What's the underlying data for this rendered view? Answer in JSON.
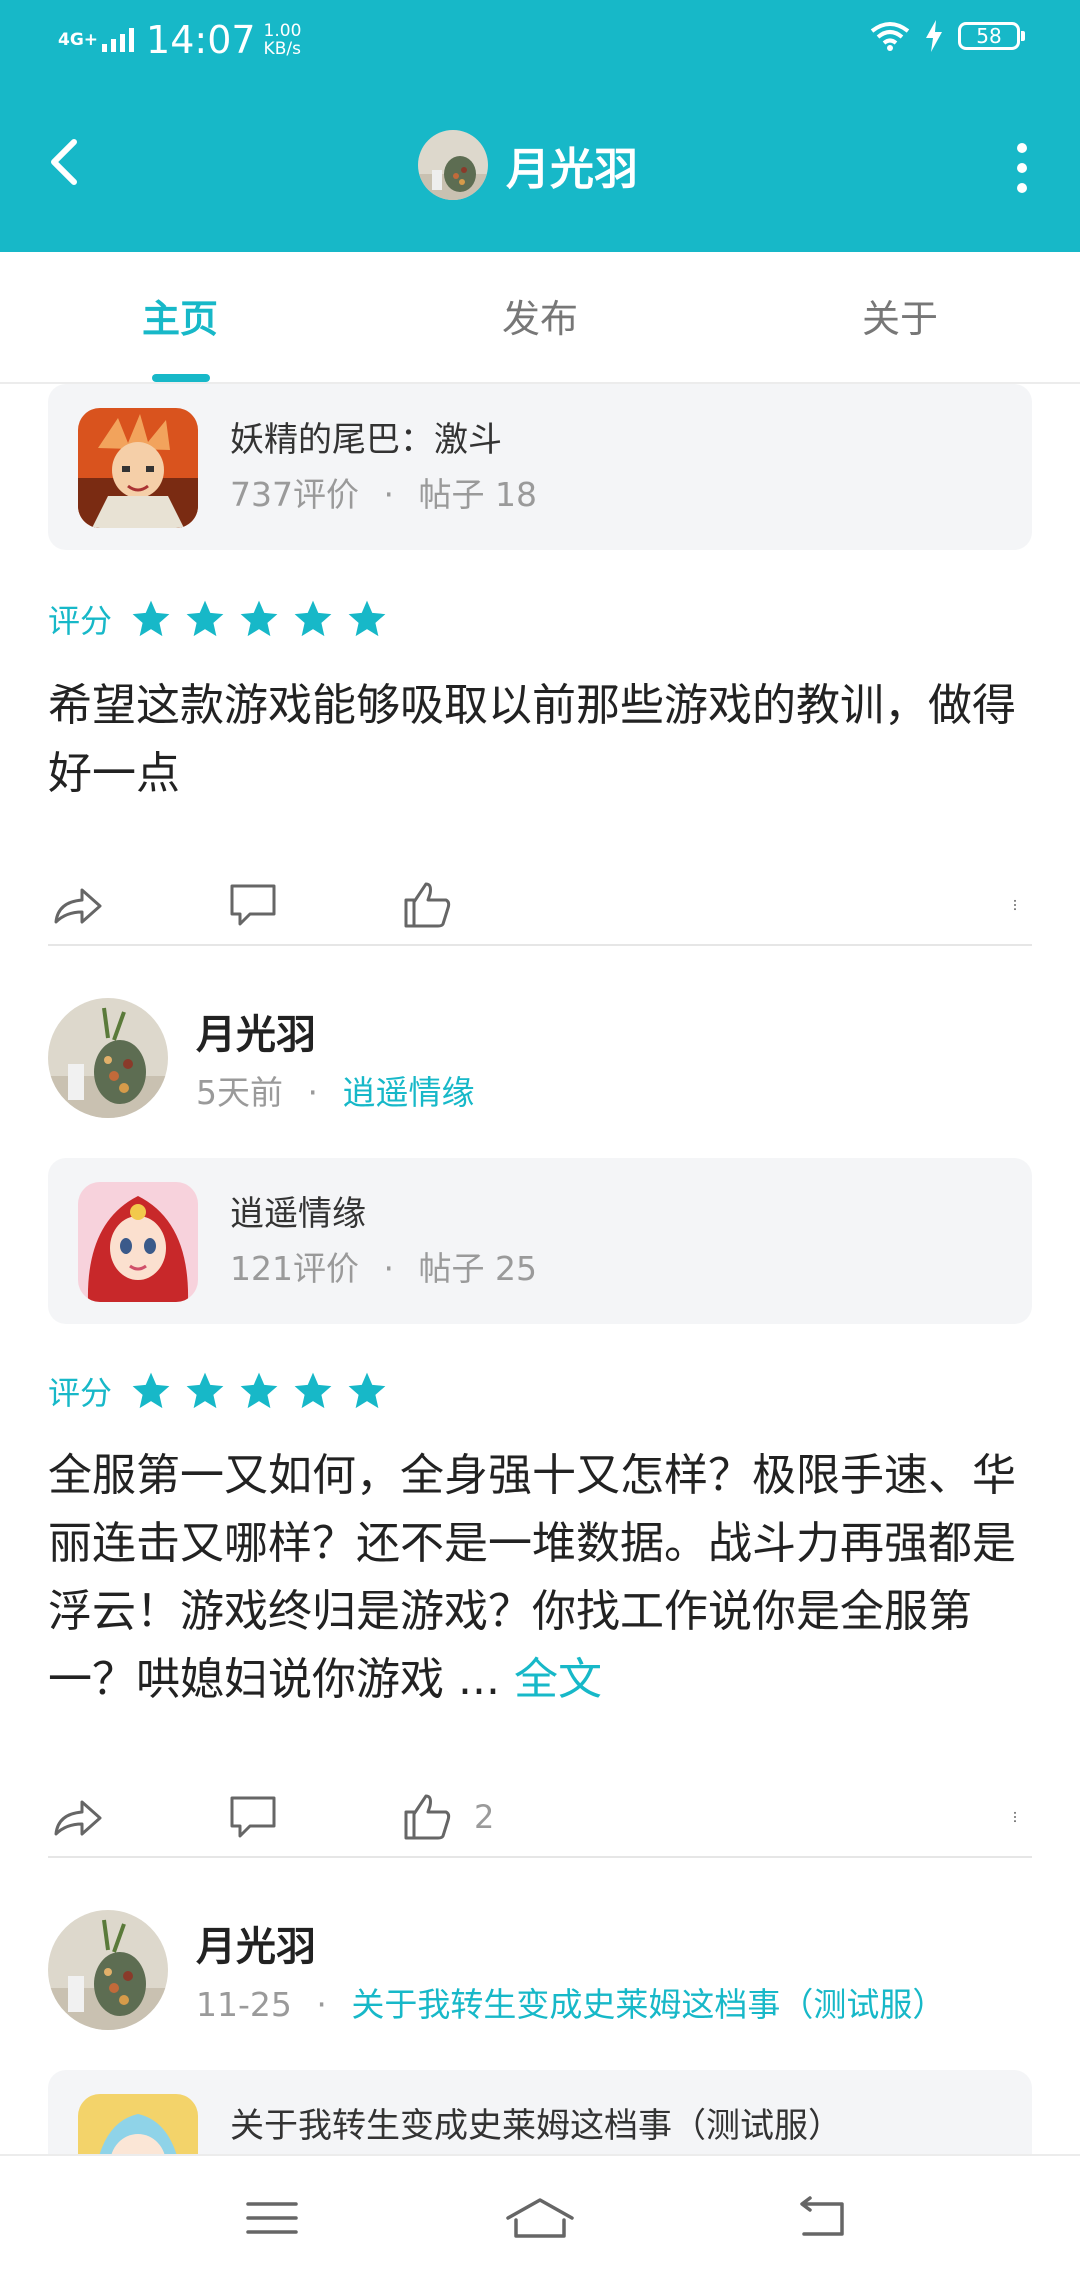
{
  "status_bar": {
    "network": "4G+",
    "time": "14:07",
    "speed_value": "1.00",
    "speed_unit": "KB/s",
    "battery": "58"
  },
  "header": {
    "title": "月光羽"
  },
  "tabs": [
    {
      "label": "主页",
      "active": true
    },
    {
      "label": "发布",
      "active": false
    },
    {
      "label": "关于",
      "active": false
    }
  ],
  "posts": [
    {
      "game": {
        "name": "妖精的尾巴：激斗",
        "reviews": "737评价",
        "posts": "帖子 18",
        "icon": "anime-hero-icon"
      },
      "rating_label": "评分",
      "rating_stars": 5,
      "text": "希望这款游戏能够吸取以前那些游戏的教训，做得好一点",
      "likes": ""
    },
    {
      "user": {
        "name": "月光羽",
        "time": "5天前",
        "game_link": "逍遥情缘"
      },
      "game": {
        "name": "逍遥情缘",
        "reviews": "121评价",
        "posts": "帖子 25",
        "icon": "red-hair-girl-icon"
      },
      "rating_label": "评分",
      "rating_stars": 5,
      "text": "全服第一又如何，全身强十又怎样？极限手速、华丽连击又哪样？还不是一堆数据。战斗力再强都是浮云！游戏终归是游戏？你找工作说你是全服第一？哄媳妇说你游戏 ...",
      "more": "全文",
      "likes": "2"
    },
    {
      "user": {
        "name": "月光羽",
        "time": "11-25",
        "game_link": "关于我转生变成史莱姆这档事（测试服）"
      },
      "game": {
        "name": "关于我转生变成史莱姆这档事（测试服）",
        "icon": "slime-anime-icon"
      }
    }
  ],
  "separator": "·",
  "colors": {
    "accent": "#17b8c8",
    "card_bg": "#f4f5f7",
    "muted_text": "#9a9a9a"
  }
}
